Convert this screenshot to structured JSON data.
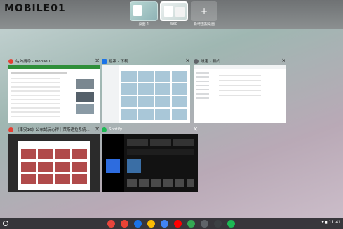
{
  "overview": {
    "logo_text": "MOBILE01",
    "desks": [
      {
        "label": "桌面 1"
      },
      {
        "label": "web"
      }
    ],
    "new_desk_label": "新增虛擬桌面",
    "new_desk_symbol": "+"
  },
  "windows": [
    {
      "title": "站內搜尋 - Mobile01",
      "icon": "chrome-icon",
      "color": "#e44134"
    },
    {
      "title": "檔案 - 下載",
      "icon": "files-icon",
      "color": "#1a73e8"
    },
    {
      "title": "設定 - 關於",
      "icon": "settings-icon",
      "color": "#5f6368"
    },
    {
      "title": "《車安16》公布試玩心得｜萊斯達拉系統...",
      "icon": "chrome-icon",
      "color": "#e44134"
    },
    {
      "title": "Spotify",
      "icon": "spotify-icon",
      "color": "#1db954"
    }
  ],
  "close_symbol": "✕",
  "shelf": {
    "apps": [
      {
        "name": "chrome-icon",
        "color": "#e8453c"
      },
      {
        "name": "gmail-icon",
        "color": "#ea4335"
      },
      {
        "name": "files-icon",
        "color": "#1a73e8"
      },
      {
        "name": "photos-icon",
        "color": "#fbbc04"
      },
      {
        "name": "docs-icon",
        "color": "#4285f4"
      },
      {
        "name": "youtube-icon",
        "color": "#ff0000"
      },
      {
        "name": "play-store-icon",
        "color": "#34a853"
      },
      {
        "name": "camera-icon",
        "color": "#5f6368"
      },
      {
        "name": "settings-icon",
        "color": "#3c4043"
      },
      {
        "name": "spotify-icon",
        "color": "#1db954"
      }
    ],
    "time": "11:41"
  }
}
